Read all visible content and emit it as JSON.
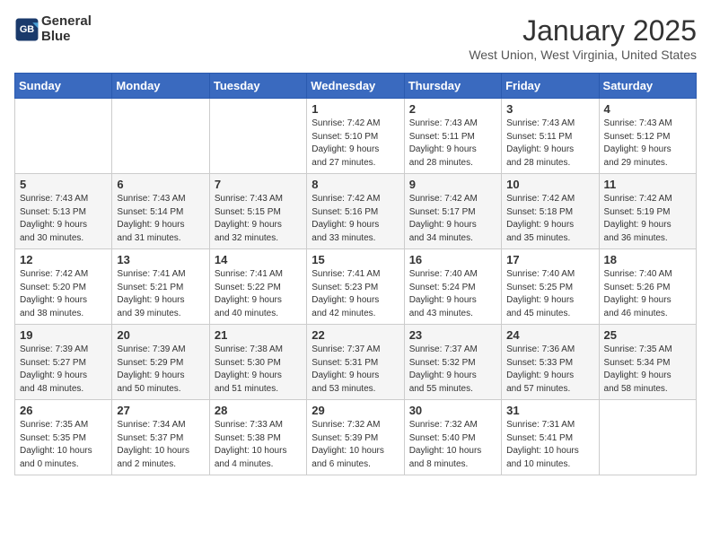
{
  "header": {
    "logo_line1": "General",
    "logo_line2": "Blue",
    "month": "January 2025",
    "location": "West Union, West Virginia, United States"
  },
  "weekdays": [
    "Sunday",
    "Monday",
    "Tuesday",
    "Wednesday",
    "Thursday",
    "Friday",
    "Saturday"
  ],
  "weeks": [
    [
      {
        "day": "",
        "info": ""
      },
      {
        "day": "",
        "info": ""
      },
      {
        "day": "",
        "info": ""
      },
      {
        "day": "1",
        "info": "Sunrise: 7:42 AM\nSunset: 5:10 PM\nDaylight: 9 hours\nand 27 minutes."
      },
      {
        "day": "2",
        "info": "Sunrise: 7:43 AM\nSunset: 5:11 PM\nDaylight: 9 hours\nand 28 minutes."
      },
      {
        "day": "3",
        "info": "Sunrise: 7:43 AM\nSunset: 5:11 PM\nDaylight: 9 hours\nand 28 minutes."
      },
      {
        "day": "4",
        "info": "Sunrise: 7:43 AM\nSunset: 5:12 PM\nDaylight: 9 hours\nand 29 minutes."
      }
    ],
    [
      {
        "day": "5",
        "info": "Sunrise: 7:43 AM\nSunset: 5:13 PM\nDaylight: 9 hours\nand 30 minutes."
      },
      {
        "day": "6",
        "info": "Sunrise: 7:43 AM\nSunset: 5:14 PM\nDaylight: 9 hours\nand 31 minutes."
      },
      {
        "day": "7",
        "info": "Sunrise: 7:43 AM\nSunset: 5:15 PM\nDaylight: 9 hours\nand 32 minutes."
      },
      {
        "day": "8",
        "info": "Sunrise: 7:42 AM\nSunset: 5:16 PM\nDaylight: 9 hours\nand 33 minutes."
      },
      {
        "day": "9",
        "info": "Sunrise: 7:42 AM\nSunset: 5:17 PM\nDaylight: 9 hours\nand 34 minutes."
      },
      {
        "day": "10",
        "info": "Sunrise: 7:42 AM\nSunset: 5:18 PM\nDaylight: 9 hours\nand 35 minutes."
      },
      {
        "day": "11",
        "info": "Sunrise: 7:42 AM\nSunset: 5:19 PM\nDaylight: 9 hours\nand 36 minutes."
      }
    ],
    [
      {
        "day": "12",
        "info": "Sunrise: 7:42 AM\nSunset: 5:20 PM\nDaylight: 9 hours\nand 38 minutes."
      },
      {
        "day": "13",
        "info": "Sunrise: 7:41 AM\nSunset: 5:21 PM\nDaylight: 9 hours\nand 39 minutes."
      },
      {
        "day": "14",
        "info": "Sunrise: 7:41 AM\nSunset: 5:22 PM\nDaylight: 9 hours\nand 40 minutes."
      },
      {
        "day": "15",
        "info": "Sunrise: 7:41 AM\nSunset: 5:23 PM\nDaylight: 9 hours\nand 42 minutes."
      },
      {
        "day": "16",
        "info": "Sunrise: 7:40 AM\nSunset: 5:24 PM\nDaylight: 9 hours\nand 43 minutes."
      },
      {
        "day": "17",
        "info": "Sunrise: 7:40 AM\nSunset: 5:25 PM\nDaylight: 9 hours\nand 45 minutes."
      },
      {
        "day": "18",
        "info": "Sunrise: 7:40 AM\nSunset: 5:26 PM\nDaylight: 9 hours\nand 46 minutes."
      }
    ],
    [
      {
        "day": "19",
        "info": "Sunrise: 7:39 AM\nSunset: 5:27 PM\nDaylight: 9 hours\nand 48 minutes."
      },
      {
        "day": "20",
        "info": "Sunrise: 7:39 AM\nSunset: 5:29 PM\nDaylight: 9 hours\nand 50 minutes."
      },
      {
        "day": "21",
        "info": "Sunrise: 7:38 AM\nSunset: 5:30 PM\nDaylight: 9 hours\nand 51 minutes."
      },
      {
        "day": "22",
        "info": "Sunrise: 7:37 AM\nSunset: 5:31 PM\nDaylight: 9 hours\nand 53 minutes."
      },
      {
        "day": "23",
        "info": "Sunrise: 7:37 AM\nSunset: 5:32 PM\nDaylight: 9 hours\nand 55 minutes."
      },
      {
        "day": "24",
        "info": "Sunrise: 7:36 AM\nSunset: 5:33 PM\nDaylight: 9 hours\nand 57 minutes."
      },
      {
        "day": "25",
        "info": "Sunrise: 7:35 AM\nSunset: 5:34 PM\nDaylight: 9 hours\nand 58 minutes."
      }
    ],
    [
      {
        "day": "26",
        "info": "Sunrise: 7:35 AM\nSunset: 5:35 PM\nDaylight: 10 hours\nand 0 minutes."
      },
      {
        "day": "27",
        "info": "Sunrise: 7:34 AM\nSunset: 5:37 PM\nDaylight: 10 hours\nand 2 minutes."
      },
      {
        "day": "28",
        "info": "Sunrise: 7:33 AM\nSunset: 5:38 PM\nDaylight: 10 hours\nand 4 minutes."
      },
      {
        "day": "29",
        "info": "Sunrise: 7:32 AM\nSunset: 5:39 PM\nDaylight: 10 hours\nand 6 minutes."
      },
      {
        "day": "30",
        "info": "Sunrise: 7:32 AM\nSunset: 5:40 PM\nDaylight: 10 hours\nand 8 minutes."
      },
      {
        "day": "31",
        "info": "Sunrise: 7:31 AM\nSunset: 5:41 PM\nDaylight: 10 hours\nand 10 minutes."
      },
      {
        "day": "",
        "info": ""
      }
    ]
  ]
}
